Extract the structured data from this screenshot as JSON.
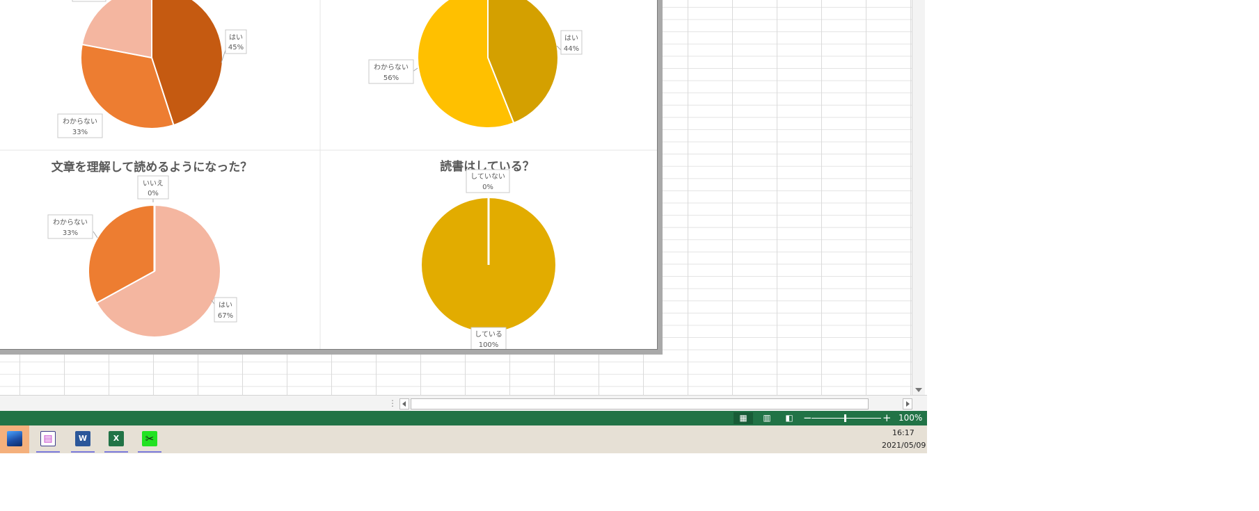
{
  "colors": {
    "excel_green": "#217346",
    "taskbar": "#e6e0d5",
    "active_task": "#f4b07c"
  },
  "chart_data": [
    {
      "type": "pie",
      "title": "",
      "start_angle_deg": 0,
      "slices": [
        {
          "label": "はい",
          "value": 45,
          "value_text": "45%",
          "color": "#C55A11"
        },
        {
          "label": "わからない",
          "value": 33,
          "value_text": "33%",
          "color": "#ED7D31"
        },
        {
          "label": "",
          "value": 22,
          "value_text": "",
          "color": "#F4B6A0"
        }
      ]
    },
    {
      "type": "pie",
      "title": "",
      "start_angle_deg": 0,
      "slices": [
        {
          "label": "はい",
          "value": 44,
          "value_text": "44%",
          "color": "#D4A000"
        },
        {
          "label": "わからない",
          "value": 56,
          "value_text": "56%",
          "color": "#FFC000"
        }
      ]
    },
    {
      "type": "pie",
      "title": "文章を理解して読めるようになった？",
      "start_angle_deg": 0,
      "slices": [
        {
          "label": "はい",
          "value": 67,
          "value_text": "67%",
          "color": "#F4B6A0"
        },
        {
          "label": "わからない",
          "value": 33,
          "value_text": "33%",
          "color": "#ED7D31"
        },
        {
          "label": "いいえ",
          "value": 0,
          "value_text": "0%",
          "color": "#C55A11"
        }
      ]
    },
    {
      "type": "pie",
      "title": "読書はしている？",
      "start_angle_deg": 0,
      "slices": [
        {
          "label": "している",
          "value": 100,
          "value_text": "100%",
          "color": "#E2AC00"
        },
        {
          "label": "していない",
          "value": 0,
          "value_text": "0%",
          "color": "#FFC000"
        }
      ]
    }
  ],
  "status_bar": {
    "zoom_level": "100%",
    "zoom_minus": "−",
    "zoom_plus": "+"
  },
  "taskbar": {
    "time": "16:17",
    "date": "2021/05/09",
    "apps": [
      {
        "name": "Photos",
        "icon": "photos-icon"
      },
      {
        "name": "Notepad",
        "icon": "notepad-icon"
      },
      {
        "name": "Word",
        "icon": "word-icon",
        "glyph": "W"
      },
      {
        "name": "Excel",
        "icon": "excel-icon",
        "glyph": "X"
      },
      {
        "name": "Snipping Tool",
        "icon": "scissors-icon",
        "glyph": "✂"
      }
    ]
  }
}
